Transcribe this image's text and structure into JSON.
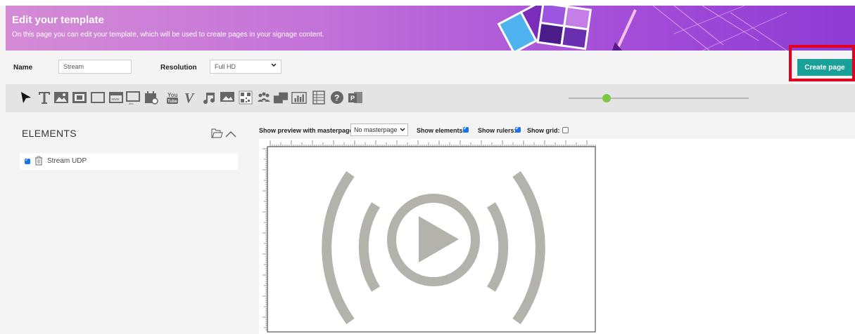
{
  "header": {
    "title": "Edit your template",
    "subtitle": "On this page you can edit your template, which will be used to create pages in your signage content."
  },
  "form": {
    "name_label": "Name",
    "name_value": "Stream",
    "resolution_label": "Resolution",
    "resolution_value": "Full HD"
  },
  "actions": {
    "create_page": "Create page"
  },
  "toolbar": {
    "tools": [
      "select-arrow-icon",
      "text-icon",
      "image-icon",
      "video-icon",
      "rectangle-icon",
      "web-page-icon",
      "ticker-icon",
      "clock-icon",
      "youtube-icon",
      "vimeo-icon",
      "audio-icon",
      "slideshow-icon",
      "qr-code-icon",
      "social-icon",
      "stream-icon",
      "chart-icon",
      "table-icon",
      "help-icon",
      "powerpoint-icon"
    ],
    "zoom_level": 0.19
  },
  "elements_panel": {
    "title": "ELEMENTS",
    "items": [
      {
        "label": "Stream UDP",
        "checked": true
      }
    ]
  },
  "canvas_options": {
    "preview_label": "Show preview with masterpage:",
    "masterpage_value": "No masterpage",
    "show_elements_label": "Show elements:",
    "show_elements": true,
    "show_rulers_label": "Show rulers:",
    "show_rulers": true,
    "show_grid_label": "Show grid:",
    "show_grid": false
  },
  "colors": {
    "accent": "#1aa197",
    "highlight": "#e2001a",
    "checkbox": "#1a73e8",
    "slider_knob": "#7ac943",
    "stream_icon": "#b3b3ac"
  }
}
